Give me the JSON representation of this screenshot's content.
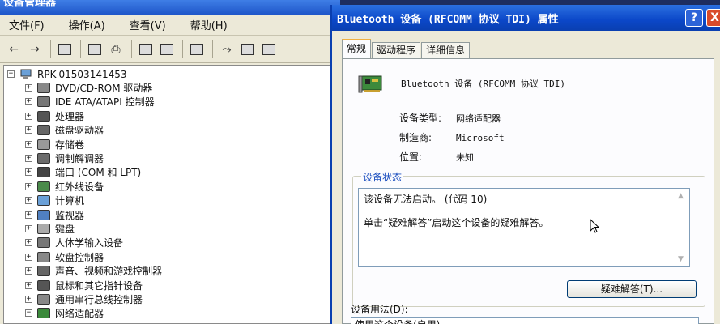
{
  "device_manager": {
    "title": "设备管理器",
    "menus": [
      "文件(F)",
      "操作(A)",
      "查看(V)",
      "帮助(H)"
    ],
    "root": "RPK-01503141453",
    "tree": [
      {
        "label": "DVD/CD-ROM 驱动器",
        "expander": "+"
      },
      {
        "label": "IDE ATA/ATAPI 控制器",
        "expander": "+"
      },
      {
        "label": "处理器",
        "expander": "+"
      },
      {
        "label": "磁盘驱动器",
        "expander": "+"
      },
      {
        "label": "存储卷",
        "expander": "+"
      },
      {
        "label": "调制解调器",
        "expander": "+"
      },
      {
        "label": "端口 (COM 和 LPT)",
        "expander": "+"
      },
      {
        "label": "红外线设备",
        "expander": "+"
      },
      {
        "label": "计算机",
        "expander": "+"
      },
      {
        "label": "监视器",
        "expander": "+"
      },
      {
        "label": "键盘",
        "expander": "+"
      },
      {
        "label": "人体学输入设备",
        "expander": "+"
      },
      {
        "label": "软盘控制器",
        "expander": "+"
      },
      {
        "label": "声音、视频和游戏控制器",
        "expander": "+"
      },
      {
        "label": "鼠标和其它指针设备",
        "expander": "+"
      },
      {
        "label": "通用串行总线控制器",
        "expander": "+"
      },
      {
        "label": "网络适配器",
        "expander": "−"
      }
    ],
    "root_expander": "−"
  },
  "properties": {
    "title": "Bluetooth 设备 (RFCOMM 协议 TDI) 属性",
    "help_label": "?",
    "close_label": "X",
    "tabs": [
      "常规",
      "驱动程序",
      "详细信息"
    ],
    "device_name": "Bluetooth 设备 (RFCOMM 协议 TDI)",
    "device_type_label": "设备类型:",
    "device_type_value": "网络适配器",
    "manufacturer_label": "制造商:",
    "manufacturer_value": "Microsoft",
    "location_label": "位置:",
    "location_value": "未知",
    "status_group_label": "设备状态",
    "status_line1": "该设备无法启动。 (代码 10)",
    "status_line2": "单击“疑难解答”启动这个设备的疑难解答。",
    "troubleshoot_label": "疑难解答(T)...",
    "usage_label": "设备用法(D):",
    "usage_value": "使用这个设备(启用)"
  },
  "colors": {
    "titlebar_blue": "#0b47c8",
    "close_red": "#d94b2b",
    "group_label_blue": "#1c4fbf"
  }
}
